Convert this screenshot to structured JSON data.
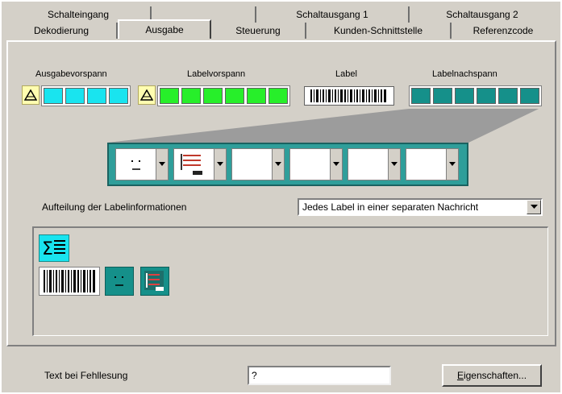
{
  "tabs": {
    "back": [
      "Schalteingang",
      "",
      "Schaltausgang 1",
      "Schaltausgang 2"
    ],
    "front": [
      "Dekodierung",
      "Ausgabe",
      "Steuerung",
      "Kunden-Schnittstelle",
      "Referenzcode"
    ]
  },
  "sections": {
    "ausgabevorspann": "Ausgabevorspann",
    "labelvorspann": "Labelvorspann",
    "label": "Label",
    "labelnachspann": "Labelnachspann"
  },
  "colors": {
    "cyan": "#19e4ef",
    "green": "#27ef2a",
    "teal": "#15908a",
    "yellow": "#fffdb0"
  },
  "aufteilung": {
    "label": "Aufteilung der Labelinformationen",
    "value": "Jedes Label in einer separaten Nachricht"
  },
  "fehllesung": {
    "label": "Text bei Fehllesung",
    "value": "?"
  },
  "button": {
    "label_pre": "",
    "label_u": "E",
    "label_post": "igenschaften..."
  },
  "icons": [
    "triangle-icon",
    "sum-icon",
    "barcode-icon",
    "face-icon",
    "list-icon"
  ]
}
